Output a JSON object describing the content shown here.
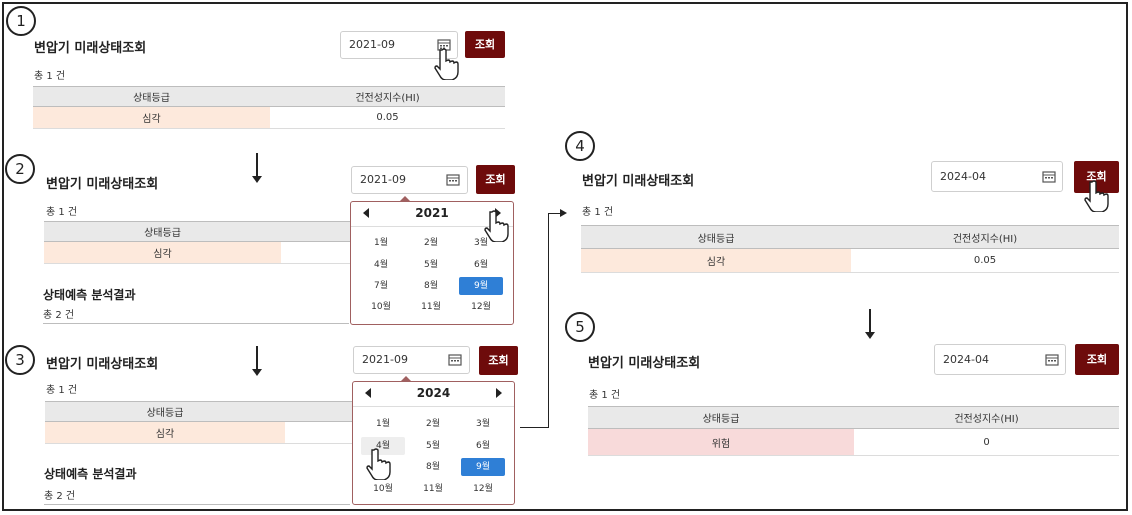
{
  "steps": [
    "1",
    "2",
    "3",
    "4",
    "5"
  ],
  "common": {
    "page_title": "변압기 미래상태조회",
    "search_label": "조회",
    "count_text": "총 1 건",
    "col_grade": "상태등급",
    "col_index": "건전성지수(HI)",
    "analysis_title": "상태예측 분석결과",
    "analysis_count": "총 2 건",
    "calendar_icon": "calendar-icon",
    "pointer_icon": "hand-pointer-icon"
  },
  "panel1": {
    "date": "2021-09",
    "grade": "심각",
    "index": "0.05"
  },
  "panel2": {
    "date": "2021-09",
    "grade": "심각",
    "picker": {
      "year": "2021",
      "selected_month": "9월"
    }
  },
  "panel3": {
    "date": "2021-09",
    "grade": "심각",
    "picker": {
      "year": "2024",
      "selected_month": "9월",
      "hover_month": "4월"
    }
  },
  "panel4": {
    "date": "2024-04",
    "grade": "심각",
    "index": "0.05"
  },
  "panel5": {
    "date": "2024-04",
    "grade": "위험",
    "index": "0"
  },
  "months": [
    "1월",
    "2월",
    "3월",
    "4월",
    "5월",
    "6월",
    "7월",
    "8월",
    "9월",
    "10월",
    "11월",
    "12월"
  ],
  "colors": {
    "button_bg": "#6e0b0b",
    "selected_month": "#2f7fd6",
    "grade_severe_bg": "#fde9dc",
    "grade_danger_bg": "#f8dada"
  }
}
